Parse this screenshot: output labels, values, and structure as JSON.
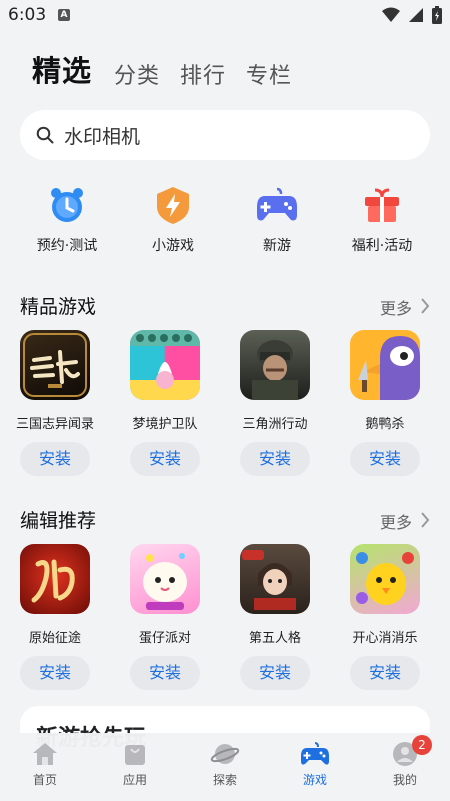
{
  "status_bar": {
    "time": "6:03",
    "notification_letter": "A"
  },
  "top_tabs": [
    {
      "label": "精选",
      "active": true
    },
    {
      "label": "分类",
      "active": false
    },
    {
      "label": "排行",
      "active": false
    },
    {
      "label": "专栏",
      "active": false
    }
  ],
  "search": {
    "placeholder": "水印相机"
  },
  "quick_entries": [
    {
      "label": "预约·测试",
      "icon": "alarm-clock-icon",
      "color": "#2f8cf3"
    },
    {
      "label": "小游戏",
      "icon": "lightning-shield-icon",
      "color": "#f59a3c"
    },
    {
      "label": "新游",
      "icon": "gamepad-icon",
      "color": "#5a6ff0"
    },
    {
      "label": "福利·活动",
      "icon": "gift-icon",
      "color": "#f2473d"
    }
  ],
  "sections": [
    {
      "title": "精品游戏",
      "more": "更多",
      "apps": [
        {
          "name": "三国志异闻录",
          "install": "安装"
        },
        {
          "name": "梦境护卫队",
          "install": "安装"
        },
        {
          "name": "三角洲行动",
          "install": "安装"
        },
        {
          "name": "鹅鸭杀",
          "install": "安装"
        }
      ]
    },
    {
      "title": "编辑推荐",
      "more": "更多",
      "apps": [
        {
          "name": "原始征途",
          "install": "安装"
        },
        {
          "name": "蛋仔派对",
          "install": "安装"
        },
        {
          "name": "第五人格",
          "install": "安装"
        },
        {
          "name": "开心消消乐",
          "install": "安装"
        }
      ]
    }
  ],
  "next_card": {
    "title": "新游抢先玩"
  },
  "bottom_nav": [
    {
      "label": "首页",
      "icon": "home-icon",
      "active": false
    },
    {
      "label": "应用",
      "icon": "shopping-bag-icon",
      "active": false
    },
    {
      "label": "探索",
      "icon": "planet-icon",
      "active": false
    },
    {
      "label": "游戏",
      "icon": "gamepad-icon",
      "active": true
    },
    {
      "label": "我的",
      "icon": "user-icon",
      "active": false,
      "badge": "2"
    }
  ],
  "colors": {
    "accent": "#1e6fe0",
    "background": "#f1f3f5",
    "badge": "#e8433b"
  }
}
